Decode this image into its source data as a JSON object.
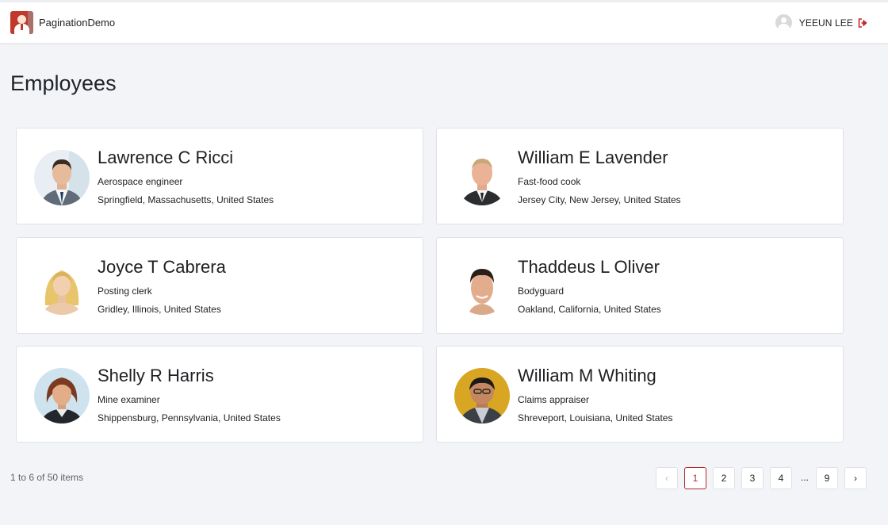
{
  "app": {
    "name": "PaginationDemo"
  },
  "user": {
    "name": "YEEUN LEE"
  },
  "page": {
    "title": "Employees"
  },
  "employees": [
    {
      "name": "Lawrence C Ricci",
      "job": "Aerospace engineer",
      "location": "Springfield, Massachusetts, United States"
    },
    {
      "name": "William E Lavender",
      "job": "Fast-food cook",
      "location": "Jersey City, New Jersey, United States"
    },
    {
      "name": "Joyce T Cabrera",
      "job": "Posting clerk",
      "location": "Gridley, Illinois, United States"
    },
    {
      "name": "Thaddeus L Oliver",
      "job": "Bodyguard",
      "location": "Oakland, California, United States"
    },
    {
      "name": "Shelly R Harris",
      "job": "Mine examiner",
      "location": "Shippensburg, Pennsylvania, United States"
    },
    {
      "name": "William M Whiting",
      "job": "Claims appraiser",
      "location": "Shreveport, Louisiana, United States"
    }
  ],
  "pagination": {
    "summary": "1 to 6 of 50 items",
    "prev": "‹",
    "next": "›",
    "pages": [
      "1",
      "2",
      "3",
      "4",
      "9"
    ],
    "ellipsis": "...",
    "current": "1"
  },
  "colors": {
    "accent": "#b3262e",
    "background": "#f3f4f7",
    "card": "#ffffff"
  }
}
